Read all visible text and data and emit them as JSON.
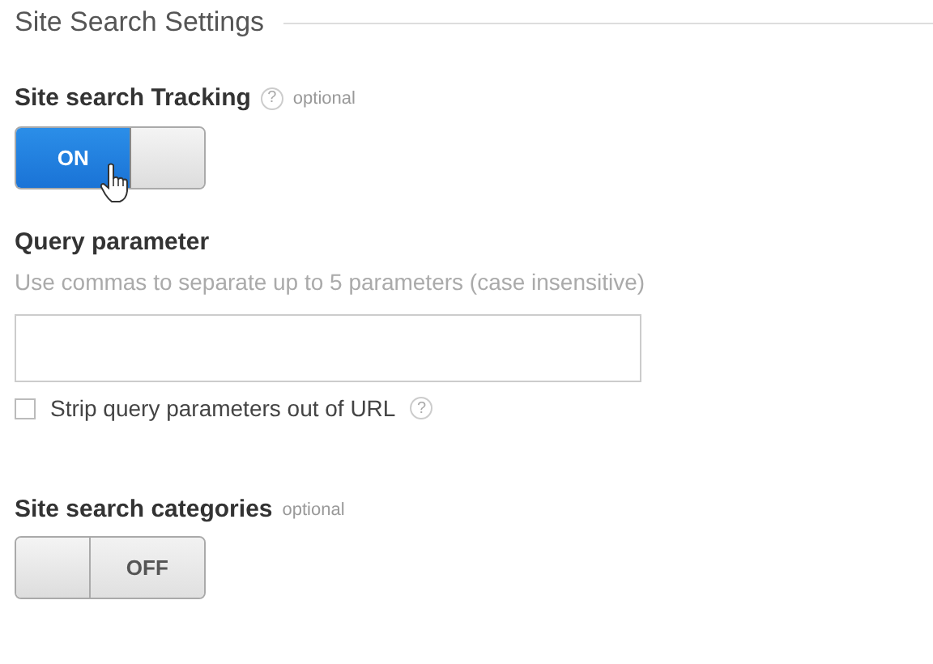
{
  "title": "Site Search Settings",
  "tracking": {
    "label": "Site search Tracking",
    "help": "?",
    "optional": "optional",
    "toggle": {
      "on": true,
      "label": "ON"
    }
  },
  "query": {
    "label": "Query parameter",
    "hint": "Use commas to separate up to 5 parameters (case insensitive)",
    "strip": {
      "label": "Strip query parameters out of URL",
      "checked": false,
      "help": "?"
    }
  },
  "categories": {
    "label": "Site search categories",
    "optional": "optional",
    "toggle": {
      "on": false,
      "label": "OFF"
    }
  }
}
